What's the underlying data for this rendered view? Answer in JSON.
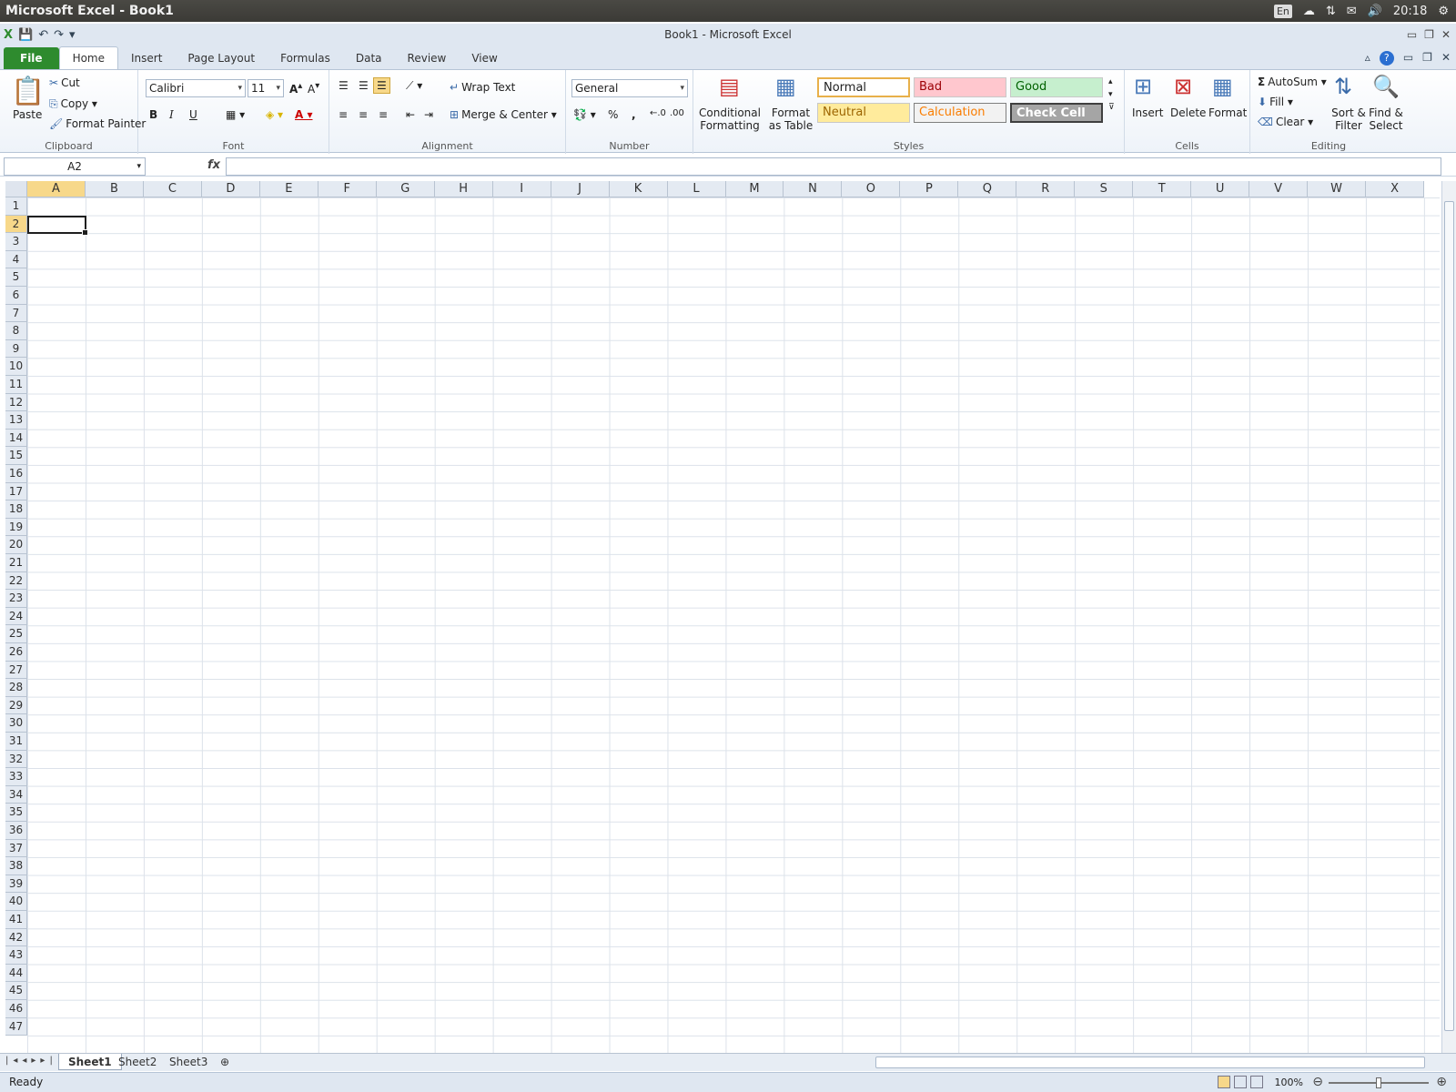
{
  "os": {
    "title": "Microsoft Excel - Book1",
    "tray": {
      "keyboard": "En",
      "time": "20:18"
    }
  },
  "window": {
    "title": "Book1 - Microsoft Excel"
  },
  "tabs": [
    "File",
    "Home",
    "Insert",
    "Page Layout",
    "Formulas",
    "Data",
    "Review",
    "View"
  ],
  "active_tab": "Home",
  "ribbon": {
    "clipboard": {
      "paste": "Paste",
      "cut": "Cut",
      "copy": "Copy",
      "format_painter": "Format Painter",
      "label": "Clipboard"
    },
    "font": {
      "family": "Calibri",
      "size": "11",
      "bold": "B",
      "italic": "I",
      "underline": "U",
      "label": "Font"
    },
    "alignment": {
      "wrap_text": "Wrap Text",
      "merge_center": "Merge & Center",
      "label": "Alignment"
    },
    "number": {
      "format": "General",
      "percent": "%",
      "comma": ",",
      "label": "Number"
    },
    "styles": {
      "conditional_formatting": "Conditional Formatting",
      "format_as_table": "Format as Table",
      "normal": "Normal",
      "bad": "Bad",
      "good": "Good",
      "neutral": "Neutral",
      "calculation": "Calculation",
      "check_cell": "Check Cell",
      "label": "Styles"
    },
    "cells": {
      "insert": "Insert",
      "delete": "Delete",
      "format": "Format",
      "label": "Cells"
    },
    "editing": {
      "autosum": "AutoSum",
      "fill": "Fill",
      "clear": "Clear",
      "sort_filter": "Sort & Filter",
      "find_select": "Find & Select",
      "label": "Editing"
    }
  },
  "formula_bar": {
    "name_box": "A2",
    "fx": "fx",
    "value": ""
  },
  "grid": {
    "columns": [
      "A",
      "B",
      "C",
      "D",
      "E",
      "F",
      "G",
      "H",
      "I",
      "J",
      "K",
      "L",
      "M",
      "N",
      "O",
      "P",
      "Q",
      "R",
      "S",
      "T",
      "U",
      "V",
      "W",
      "X"
    ],
    "rows": [
      "1",
      "2",
      "3",
      "4",
      "5",
      "6",
      "7",
      "8",
      "9",
      "10",
      "11",
      "12",
      "13",
      "14",
      "15",
      "16",
      "17",
      "18",
      "19",
      "20",
      "21",
      "22",
      "23",
      "24",
      "25",
      "26",
      "27",
      "28",
      "29",
      "30",
      "31",
      "32",
      "33",
      "34",
      "35",
      "36",
      "37",
      "38",
      "39",
      "40",
      "41",
      "42",
      "43",
      "44",
      "45",
      "46",
      "47"
    ],
    "active_column": "A",
    "active_row": "2"
  },
  "sheets": [
    "Sheet1",
    "Sheet2",
    "Sheet3"
  ],
  "active_sheet": "Sheet1",
  "status": {
    "text": "Ready",
    "zoom": "100%"
  },
  "colors": {
    "file_tab": "#2e8b2e",
    "selected_header": "#f7d88a",
    "accent": "#2b6fd1"
  }
}
